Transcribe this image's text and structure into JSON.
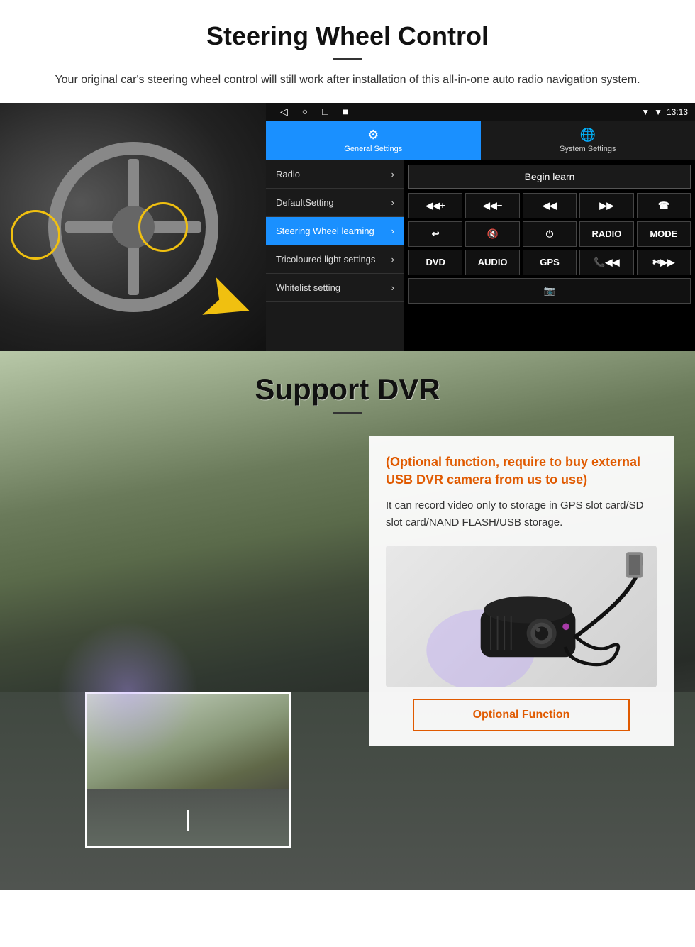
{
  "page": {
    "section1": {
      "title": "Steering Wheel Control",
      "description": "Your original car's steering wheel control will still work after installation of this all-in-one auto radio navigation system.",
      "android_ui": {
        "status_bar": {
          "time": "13:13",
          "nav_buttons": [
            "◁",
            "○",
            "□",
            "■"
          ]
        },
        "tabs": [
          {
            "label": "General Settings",
            "active": true,
            "icon": "⚙"
          },
          {
            "label": "System Settings",
            "active": false,
            "icon": "🌐"
          }
        ],
        "menu_items": [
          {
            "label": "Radio",
            "active": false
          },
          {
            "label": "DefaultSetting",
            "active": false
          },
          {
            "label": "Steering Wheel learning",
            "active": true
          },
          {
            "label": "Tricoloured light settings",
            "active": false
          },
          {
            "label": "Whitelist setting",
            "active": false
          }
        ],
        "begin_learn_button": "Begin learn",
        "control_buttons_row1": [
          "◀◀+",
          "◀◀-",
          "◀◀",
          "▶▶",
          "☎"
        ],
        "control_buttons_row2": [
          "↩",
          "🔇",
          "⏻",
          "RADIO",
          "MODE"
        ],
        "control_buttons_row3": [
          "DVD",
          "AUDIO",
          "GPS",
          "📞◀◀",
          "✄▶▶"
        ],
        "control_buttons_row4": [
          "📷"
        ]
      }
    },
    "section2": {
      "title": "Support DVR",
      "info_card": {
        "title_text": "(Optional function, require to buy external USB DVR camera from us to use)",
        "description": "It can record video only to storage in GPS slot card/SD slot card/NAND FLASH/USB storage.",
        "optional_button": "Optional Function"
      }
    }
  }
}
